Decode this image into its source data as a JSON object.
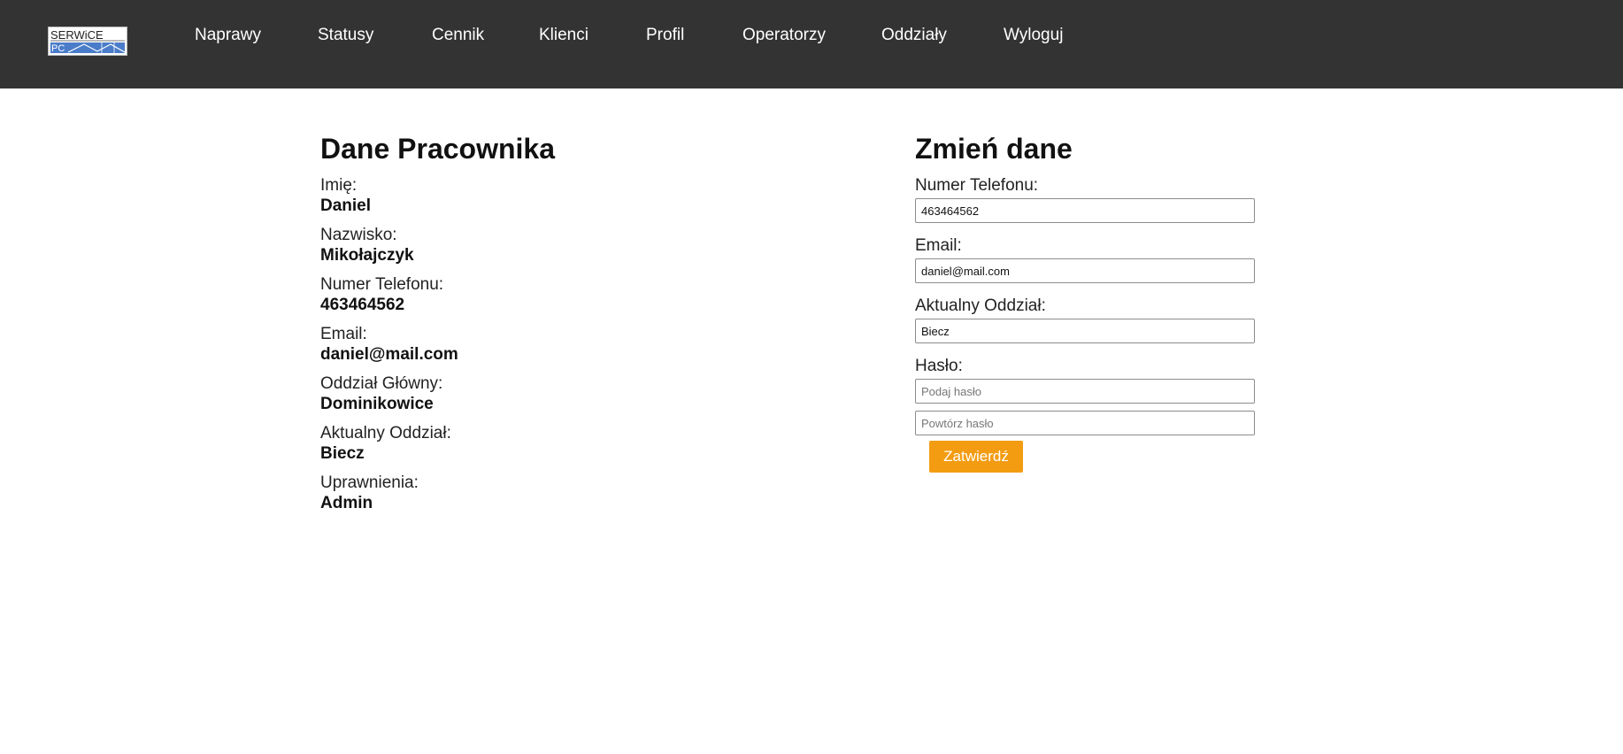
{
  "logo": {
    "line1": "SERWiCE",
    "line2": "PC"
  },
  "nav": {
    "items": [
      "Naprawy",
      "Statusy",
      "Cennik",
      "Klienci",
      "Profil",
      "Operatorzy",
      "Oddziały",
      "Wyloguj"
    ]
  },
  "employee": {
    "title": "Dane Pracownika",
    "fields": [
      {
        "label": "Imię:",
        "value": "Daniel"
      },
      {
        "label": "Nazwisko:",
        "value": "Mikołajczyk"
      },
      {
        "label": "Numer Telefonu:",
        "value": "463464562"
      },
      {
        "label": "Email:",
        "value": "daniel@mail.com"
      },
      {
        "label": "Oddział Główny:",
        "value": "Dominikowice"
      },
      {
        "label": "Aktualny Oddział:",
        "value": "Biecz"
      },
      {
        "label": "Uprawnienia:",
        "value": "Admin"
      }
    ]
  },
  "form": {
    "title": "Zmień dane",
    "phone": {
      "label": "Numer Telefonu:",
      "value": "463464562"
    },
    "email": {
      "label": "Email:",
      "value": "daniel@mail.com"
    },
    "branch": {
      "label": "Aktualny Oddział:",
      "value": "Biecz"
    },
    "password": {
      "label": "Hasło:",
      "placeholder": "Podaj hasło",
      "repeat_placeholder": "Powtórz hasło"
    },
    "submit_label": "Zatwierdź"
  },
  "colors": {
    "navbar": "#333333",
    "accent": "#f39c12",
    "logo_blue": "#4a7cc9"
  }
}
